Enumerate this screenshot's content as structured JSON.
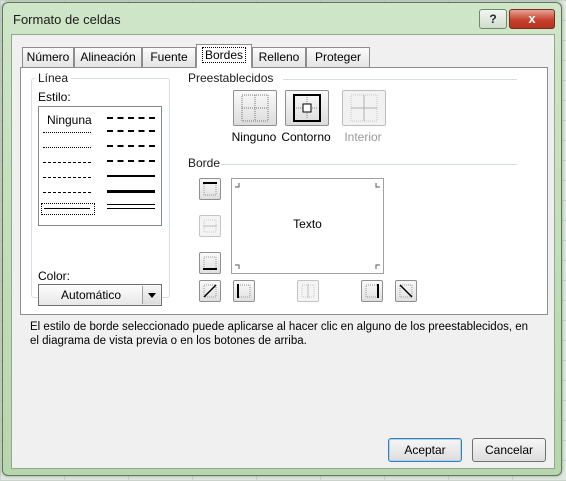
{
  "dialog": {
    "title": "Formato de celdas",
    "help_label": "?",
    "close_label": "x"
  },
  "tabs": [
    {
      "label": "Número",
      "active": false
    },
    {
      "label": "Alineación",
      "active": false
    },
    {
      "label": "Fuente",
      "active": false
    },
    {
      "label": "Bordes",
      "active": true
    },
    {
      "label": "Relleno",
      "active": false
    },
    {
      "label": "Proteger",
      "active": false
    }
  ],
  "line_group": {
    "legend": "Línea",
    "style_label": "Estilo:",
    "style_none": "Ninguna",
    "color_label": "Color:",
    "color_value": "Automático"
  },
  "presets": {
    "legend": "Preestablecidos",
    "items": [
      {
        "label": "Ninguno",
        "enabled": true
      },
      {
        "label": "Contorno",
        "enabled": true
      },
      {
        "label": "Interior",
        "enabled": false
      }
    ]
  },
  "border": {
    "legend": "Borde",
    "preview_text": "Texto"
  },
  "help_text": "El estilo de borde seleccionado puede aplicarse al hacer clic en alguno de los preestablecidos, en el diagrama de vista previa o en los botones de arriba.",
  "buttons": {
    "accept": "Aceptar",
    "cancel": "Cancelar"
  },
  "colors": {
    "title_bar": "#b7d6ad",
    "close": "#c7412f",
    "focus_border": "#3c7fb1"
  }
}
